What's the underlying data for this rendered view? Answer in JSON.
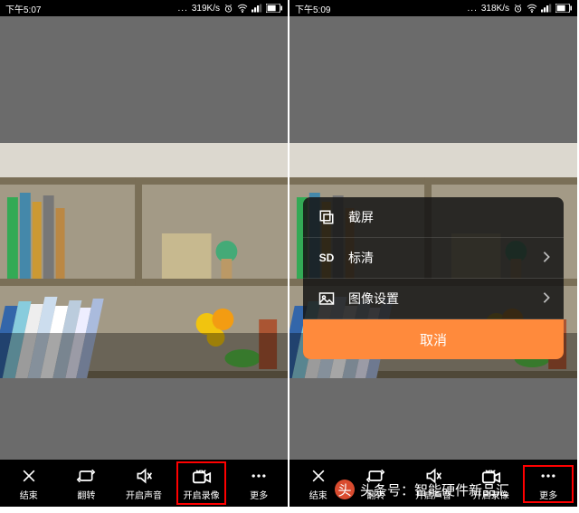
{
  "left": {
    "status": {
      "time": "下午5:07",
      "net": "319K/s"
    },
    "toolbar": {
      "end": {
        "label": "结束"
      },
      "flip": {
        "label": "翻转"
      },
      "sound": {
        "label": "开启声音"
      },
      "rec": {
        "label": "开启录像"
      },
      "more": {
        "label": "更多"
      }
    }
  },
  "right": {
    "status": {
      "time": "下午5:09",
      "net": "318K/s"
    },
    "toolbar": {
      "end": {
        "label": "结束"
      },
      "flip": {
        "label": "翻转"
      },
      "sound": {
        "label": "开启声音"
      },
      "rec": {
        "label": "开启录像"
      },
      "more": {
        "label": "更多"
      }
    },
    "sheet": {
      "screenshot": {
        "label": "截屏"
      },
      "quality": {
        "badge": "SD",
        "label": "标清"
      },
      "image": {
        "label": "图像设置"
      },
      "cancel": {
        "label": "取消"
      }
    }
  },
  "watermark": {
    "badge": "头",
    "text": "头条号：智能硬件新品汇"
  },
  "colors": {
    "accent": "#ff8a3c",
    "highlight": "#ff0000"
  }
}
